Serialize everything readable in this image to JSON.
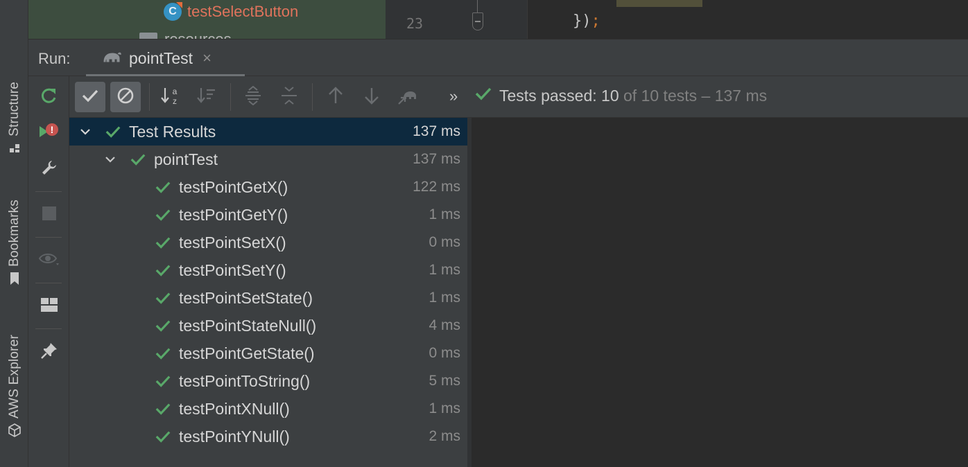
{
  "side_tabs": {
    "structure": "Structure",
    "bookmarks": "Bookmarks",
    "aws_explorer": "AWS Explorer"
  },
  "project_tree": {
    "class_icon_letter": "C",
    "class_name": "testSelectButton",
    "folder_name": "resources"
  },
  "editor": {
    "line_number": "23",
    "code_brace": "});",
    "code_close": "})",
    "code_semicolon": ";"
  },
  "run_panel": {
    "label": "Run:",
    "tab_title": "pointTest",
    "tab_close": "×"
  },
  "test_toolbar": {
    "more": "»",
    "status": {
      "passed_label": "Tests passed:",
      "passed_count": "10",
      "of_text": "of 10 tests – 137 ms"
    }
  },
  "test_tree": {
    "root": {
      "name": "Test Results",
      "time": "137 ms"
    },
    "suite": {
      "name": "pointTest",
      "time": "137 ms"
    },
    "tests": [
      {
        "name": "testPointGetX()",
        "time": "122 ms"
      },
      {
        "name": "testPointGetY()",
        "time": "1 ms"
      },
      {
        "name": "testPointSetX()",
        "time": "0 ms"
      },
      {
        "name": "testPointSetY()",
        "time": "1 ms"
      },
      {
        "name": "testPointSetState()",
        "time": "1 ms"
      },
      {
        "name": "testPointStateNull()",
        "time": "4 ms"
      },
      {
        "name": "testPointGetState()",
        "time": "0 ms"
      },
      {
        "name": "testPointToString()",
        "time": "5 ms"
      },
      {
        "name": "testPointXNull()",
        "time": "1 ms"
      },
      {
        "name": "testPointYNull()",
        "time": "2 ms"
      }
    ]
  },
  "colors": {
    "pass_green": "#59a869",
    "selection": "#0d293e",
    "panel": "#3c3f41",
    "editor_bg": "#2b2b2b"
  }
}
